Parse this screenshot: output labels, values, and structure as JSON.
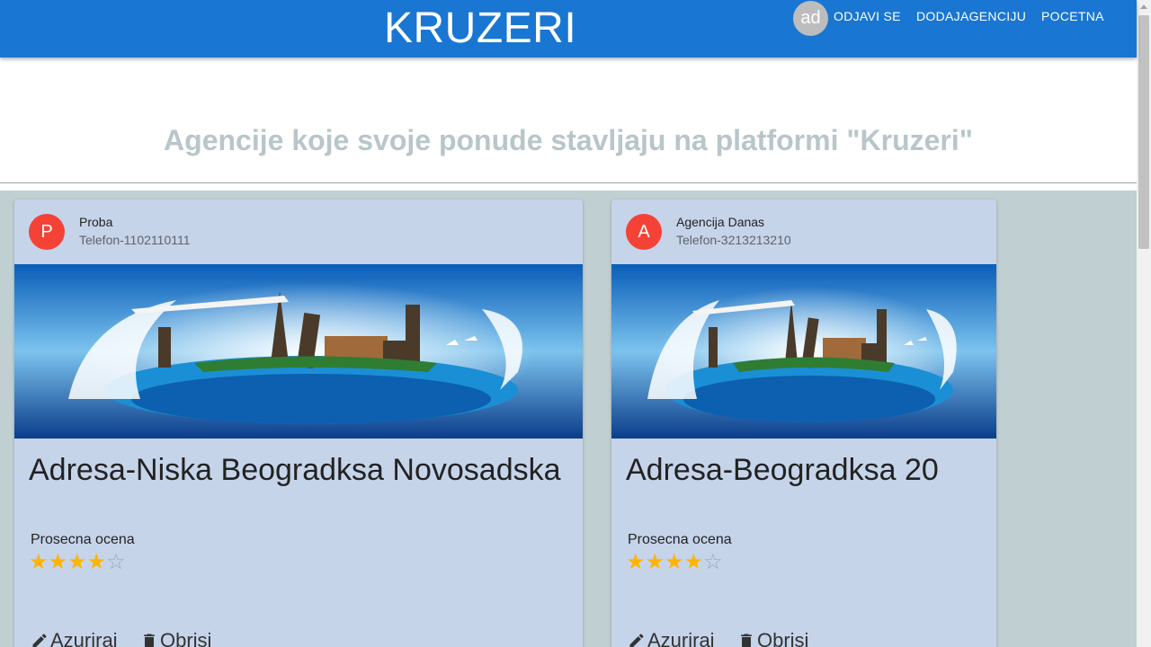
{
  "appbar": {
    "brand": "KRUZERI",
    "avatar_initials": "ad",
    "nav": [
      "ODJAVI SE",
      "DODAJAGENCIJU",
      "POCETNA"
    ]
  },
  "hero": {
    "title": "Agencije koje svoje ponude stavljaju na platformi \"Kruzeri\""
  },
  "agencies": [
    {
      "avatar_letter": "P",
      "name": "Proba",
      "phone": "Telefon-1102110111",
      "address": "Adresa-Niska Beogradksa Novosadska",
      "rating_label": "Prosecna ocena",
      "rating": 4,
      "rating_max": 5,
      "edit_label": "Azuriraj",
      "delete_label": "Obrisi"
    },
    {
      "avatar_letter": "A",
      "name": "Agencija Danas",
      "phone": "Telefon-3213213210",
      "address": "Adresa-Beogradksa 20",
      "rating_label": "Prosecna ocena",
      "rating": 4,
      "rating_max": 5,
      "edit_label": "Azuriraj",
      "delete_label": "Obrisi"
    }
  ],
  "colors": {
    "appbar": "#1976d2",
    "card_bg": "#c6d4ea",
    "page_bg": "#c0cfd2",
    "avatar": "#f44336",
    "star": "#ffb400",
    "hero_title": "#b8c6c9"
  },
  "icons": {
    "edit": "pencil-icon",
    "delete": "trash-icon",
    "star_full": "star-icon",
    "star_empty": "star-outline-icon"
  }
}
